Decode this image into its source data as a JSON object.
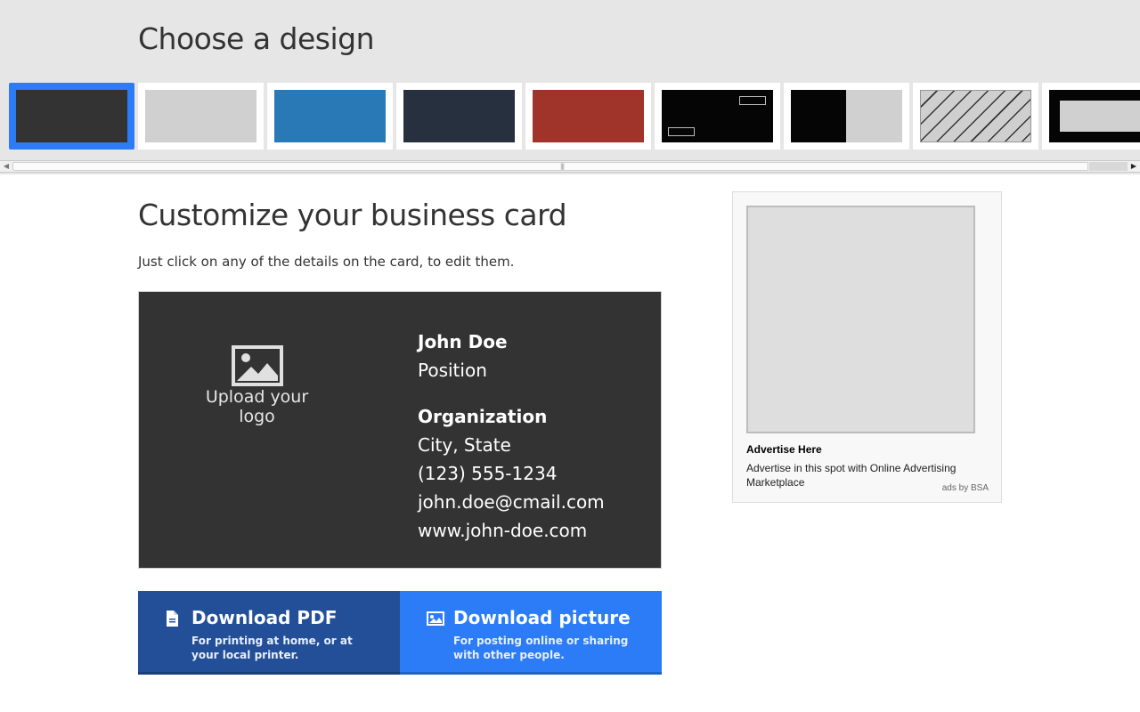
{
  "header": {
    "title": "Choose a design"
  },
  "designs": [
    {
      "name": "dark",
      "color": "#333333"
    },
    {
      "name": "light-gray",
      "color": "#d0d0d0"
    },
    {
      "name": "blue",
      "color": "#2979b7"
    },
    {
      "name": "navy",
      "color": "#27303e"
    },
    {
      "name": "red",
      "color": "#a0342a"
    },
    {
      "name": "black-boxes",
      "color": "#050505"
    },
    {
      "name": "black-gray-split",
      "color": "#050505"
    },
    {
      "name": "diagonal-stripes",
      "color": "#cfcfcf"
    },
    {
      "name": "black-frame",
      "color": "#050505"
    }
  ],
  "selected_design_index": 0,
  "main": {
    "title": "Customize your business card",
    "subtitle": "Just click on any of the details on the card, to edit them."
  },
  "card": {
    "logo_text": "Upload your logo",
    "name": "John Doe",
    "position": "Position",
    "organization": "Organization",
    "location": "City, State",
    "phone": "(123) 555-1234",
    "email": "john.doe@cmail.com",
    "website": "www.john-doe.com"
  },
  "buttons": {
    "pdf": {
      "label": "Download PDF",
      "description": "For printing at home, or at your local printer."
    },
    "picture": {
      "label": "Download picture",
      "description": "For posting online or sharing with other people."
    }
  },
  "ad": {
    "title": "Advertise Here",
    "text": "Advertise in this spot with Online Advertising Marketplace",
    "by": "ads by BSA"
  },
  "colors": {
    "accent": "#2b7cf6",
    "pdf_button": "#234f99",
    "card_bg": "#333333"
  }
}
